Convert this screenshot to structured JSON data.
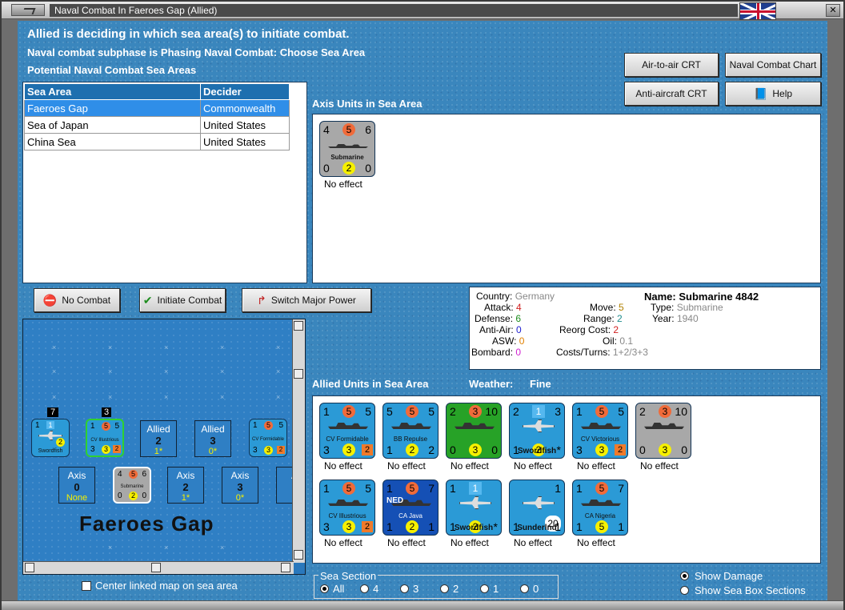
{
  "window": {
    "title": "Naval Combat In Faeroes Gap (Allied)"
  },
  "header": {
    "line1": "Allied is deciding in which sea area(s) to initiate combat.",
    "line2": "Naval combat subphase is Phasing Naval Combat: Choose Sea Area",
    "line3": "Potential Naval Combat Sea Areas"
  },
  "buttons": {
    "air_crt": "Air-to-air CRT",
    "naval_chart": "Naval Combat Chart",
    "aa_crt": "Anti-aircraft CRT",
    "help": "Help",
    "no_combat": "No Combat",
    "initiate": "Initiate Combat",
    "switch": "Switch Major Power"
  },
  "sea_table": {
    "headers": [
      "Sea Area",
      "Decider"
    ],
    "rows": [
      {
        "area": "Faeroes Gap",
        "decider": "Commonwealth"
      },
      {
        "area": "Sea of Japan",
        "decider": "United States"
      },
      {
        "area": "China Sea",
        "decider": "United States"
      }
    ]
  },
  "axis_section": {
    "label": "Axis Units in Sea Area",
    "units": [
      {
        "name": "Submarine",
        "tl": "4",
        "tc": "5",
        "tr": "6",
        "bl": "0",
        "bc": "2",
        "br": "0",
        "effect": "No effect"
      }
    ]
  },
  "stats": {
    "country_label": "Country:",
    "country": "Germany",
    "attack_label": "Attack:",
    "attack": "4",
    "defense_label": "Defense:",
    "defense": "6",
    "aa_label": "Anti-Air:",
    "aa": "0",
    "asw_label": "ASW:",
    "asw": "0",
    "bombard_label": "Bombard:",
    "bombard": "0",
    "move_label": "Move:",
    "move": "5",
    "range_label": "Range:",
    "range": "2",
    "reorg_label": "Reorg Cost:",
    "reorg": "2",
    "oil_label": "Oil:",
    "oil": "0.1",
    "costs_label": "Costs/Turns:",
    "costs": "1+2/3+3",
    "name_label": "Name:",
    "name": "Submarine 4842",
    "type_label": "Type:",
    "type": "Submarine",
    "year_label": "Year:",
    "year": "1940"
  },
  "allied_section": {
    "label": "Allied Units in Sea Area",
    "weather_label": "Weather:",
    "weather": "Fine",
    "units": [
      {
        "name": "CV Formidable",
        "tl": "1",
        "tc": "5",
        "tr": "5",
        "bl": "3",
        "bc": "3",
        "br": "2",
        "effect": "No effect"
      },
      {
        "name": "BB Repulse",
        "tl": "5",
        "tc": "5",
        "tr": "5",
        "bl": "1",
        "bc": "2",
        "br": "2",
        "effect": "No effect"
      },
      {
        "name": "",
        "tl": "2",
        "tc": "3",
        "tr": "10",
        "bl": "0",
        "bc": "3",
        "br": "0",
        "effect": "No effect"
      },
      {
        "name": "Swordfish",
        "tl": "2",
        "tc": "1",
        "tr": "3",
        "bl": "1",
        "bc": "2",
        "br": "*",
        "effect": "No effect"
      },
      {
        "name": "CV Victorious",
        "tl": "1",
        "tc": "5",
        "tr": "5",
        "bl": "3",
        "bc": "3",
        "br": "2",
        "effect": "No effect"
      },
      {
        "name": "",
        "tl": "2",
        "tc": "3",
        "tr": "10",
        "bl": "0",
        "bc": "3",
        "br": "0",
        "effect": "No effect"
      },
      {
        "name": "CV Illustrious",
        "tl": "1",
        "tc": "5",
        "tr": "5",
        "bl": "3",
        "bc": "3",
        "br": "2",
        "effect": "No effect"
      },
      {
        "name": "CA Java",
        "tl": "1",
        "tc": "5",
        "tr": "7",
        "bl": "1",
        "bc": "2",
        "br": "1",
        "effect": "No effect",
        "tag": "NED"
      },
      {
        "name": "Swordfish",
        "tl": "1",
        "tc": "1",
        "tr": "",
        "bl": "1",
        "bc": "2",
        "br": "*",
        "effect": "No effect"
      },
      {
        "name": "Sunderlnd",
        "tl": "",
        "tc": "",
        "tr": "1",
        "bl": "1",
        "bc": "20",
        "br": "1",
        "effect": "No effect"
      },
      {
        "name": "CA Nigeria",
        "tl": "1",
        "tc": "5",
        "tr": "7",
        "bl": "1",
        "bc": "5",
        "br": "1",
        "effect": "No effect"
      }
    ]
  },
  "map": {
    "sea_name": "Faeroes Gap",
    "allied_boxes": [
      {
        "label": "Allied",
        "value": "2",
        "sub": "1*"
      },
      {
        "label": "Allied",
        "value": "3",
        "sub": "0*"
      }
    ],
    "axis_boxes": [
      {
        "label": "Axis",
        "value": "0",
        "sub": "None"
      },
      {
        "label": "Axis",
        "value": "2",
        "sub": "1*"
      },
      {
        "label": "Axis",
        "value": "3",
        "sub": "0*"
      },
      {
        "label": "A",
        "value": "",
        "sub": ""
      }
    ],
    "stack_counts": [
      "7",
      "3"
    ],
    "counters": [
      {
        "name": "Swordfish",
        "tl": "1",
        "tc": "1",
        "tr": "",
        "bl": "1",
        "bc": "2",
        "br": ""
      },
      {
        "name": "CV Illustrious",
        "tl": "1",
        "tc": "5",
        "tr": "5",
        "bl": "3",
        "bc": "3",
        "br": "2"
      },
      {
        "name": "CV Formidable",
        "tl": "1",
        "tc": "5",
        "tr": "5",
        "bl": "3",
        "bc": "3",
        "br": "2"
      },
      {
        "name": "Submarine",
        "tl": "4",
        "tc": "5",
        "tr": "6",
        "bl": "0",
        "bc": "2",
        "br": "0"
      }
    ]
  },
  "options": {
    "center_map": "Center linked map on sea area",
    "sea_section": "Sea Section",
    "sections": [
      "All",
      "4",
      "3",
      "2",
      "1",
      "0"
    ],
    "show_damage": "Show Damage",
    "show_boxes": "Show Sea Box Sections"
  }
}
